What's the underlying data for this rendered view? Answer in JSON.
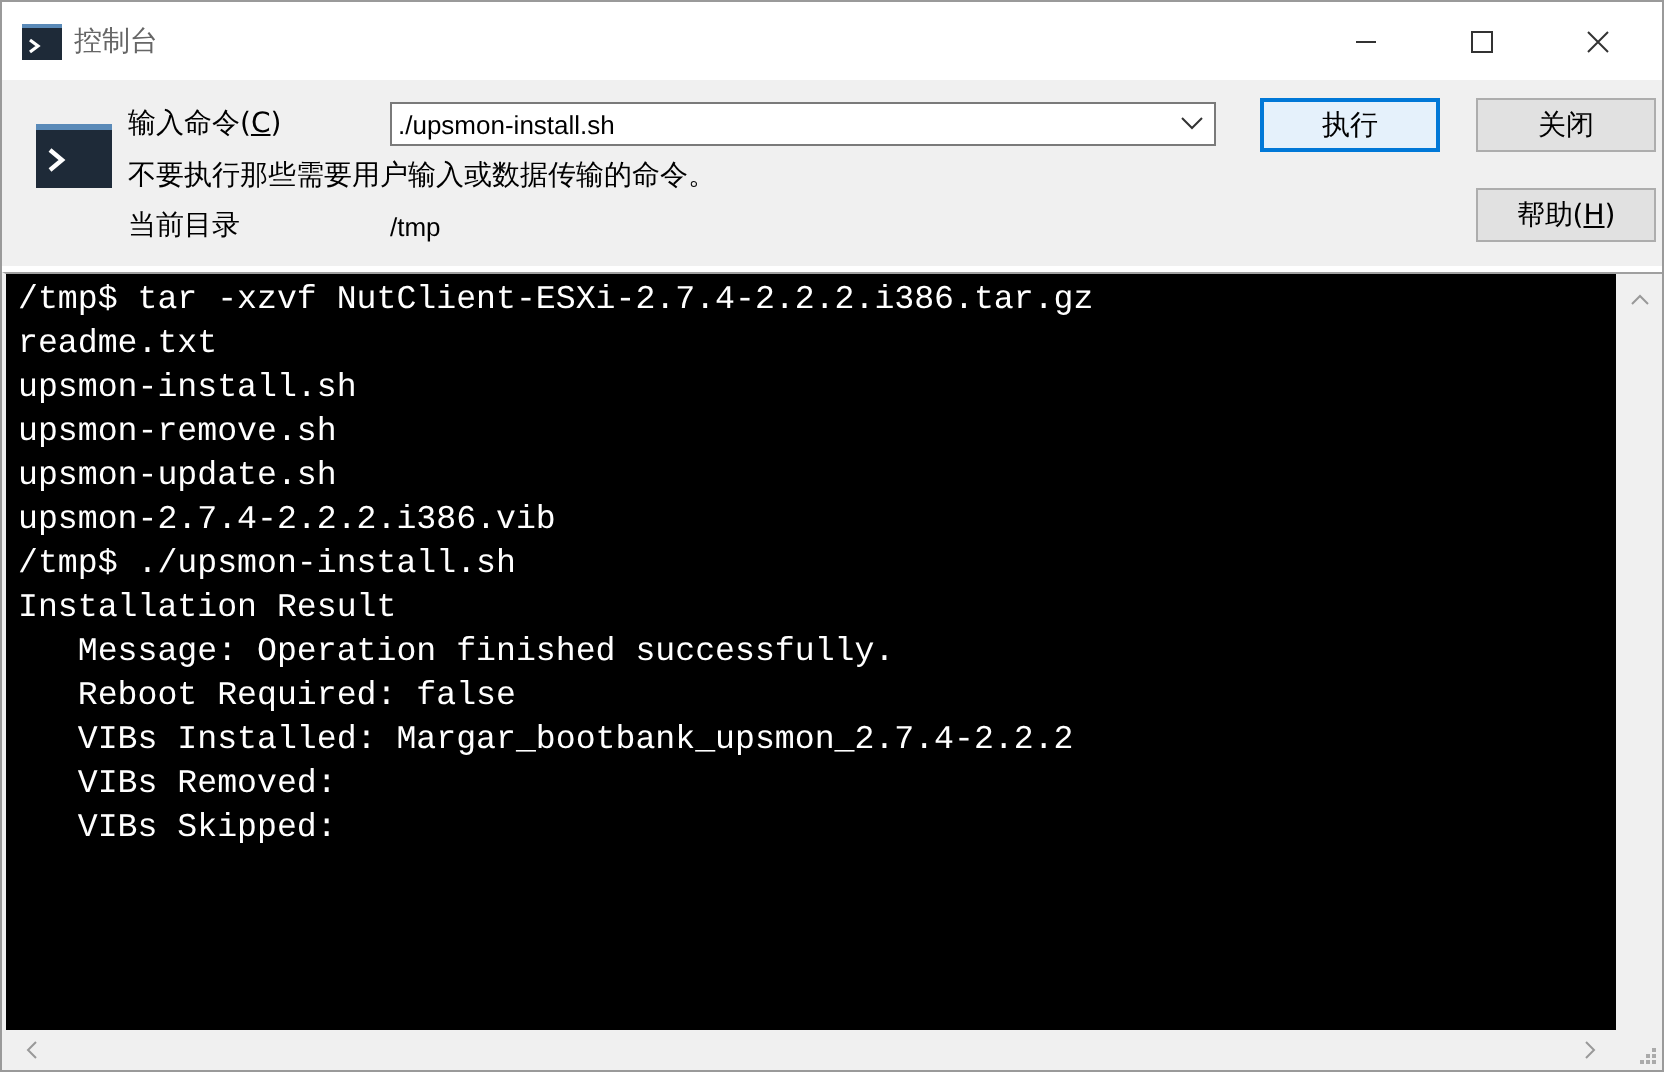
{
  "window": {
    "title": "控制台"
  },
  "command": {
    "label": {
      "before": "输入命令(",
      "key": "C",
      "after": ")"
    },
    "value": "./upsmon-install.sh"
  },
  "warning": "不要执行那些需要用户输入或数据传输的命令。",
  "current_dir": {
    "label": "当前目录",
    "value": "/tmp"
  },
  "buttons": [
    {
      "before": "执行",
      "default": true
    },
    {
      "before": "关闭",
      "default": false
    },
    {
      "before": "帮助(",
      "key": "H",
      "after": ")",
      "default": false
    }
  ],
  "console": {
    "lines": [
      "/tmp$ tar -xzvf NutClient-ESXi-2.7.4-2.2.2.i386.tar.gz",
      "readme.txt",
      "upsmon-install.sh",
      "upsmon-remove.sh",
      "upsmon-update.sh",
      "upsmon-2.7.4-2.2.2.i386.vib",
      "/tmp$ ./upsmon-install.sh",
      "Installation Result",
      "   Message: Operation finished successfully.",
      "   Reboot Required: false",
      "   VIBs Installed: Margar_bootbank_upsmon_2.7.4-2.2.2",
      "   VIBs Removed:",
      "   VIBs Skipped:"
    ]
  }
}
